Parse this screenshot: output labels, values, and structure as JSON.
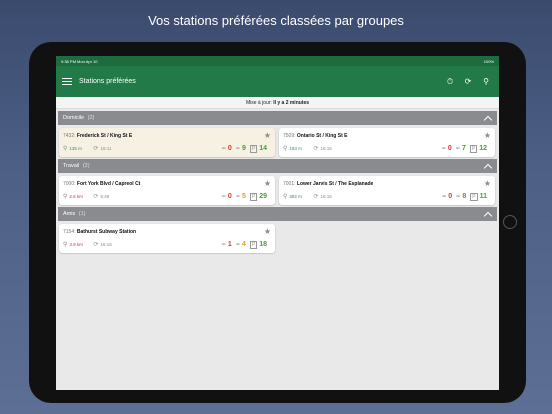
{
  "headline": "Vos stations préférées classées par groupes",
  "statusbar": {
    "left": "9:38 PM  Mon Apr 10",
    "right": "100%"
  },
  "appbar": {
    "title": "Stations préférées",
    "icons": [
      "timer-icon",
      "refresh-icon",
      "search-icon"
    ]
  },
  "update": {
    "label": "Mise à jour:",
    "value": "Il y a 2 minutes"
  },
  "groups": [
    {
      "name": "Domicile",
      "count": "(2)",
      "stations": [
        {
          "code": "7432:",
          "name": "Frederick St / King St E",
          "distance": "135 m",
          "time": "16:11",
          "bikes_broken": "0",
          "bikes": "9",
          "docks": "14",
          "dist_color": "green",
          "bikes_color": "green"
        },
        {
          "code": "7509:",
          "name": "Ontario St / King St E",
          "distance": "183 m",
          "time": "16:16",
          "bikes_broken": "0",
          "bikes": "7",
          "docks": "12",
          "dist_color": "green",
          "bikes_color": "green"
        }
      ]
    },
    {
      "name": "Travail",
      "count": "(2)",
      "stations": [
        {
          "code": "7000:",
          "name": "Fort York Blvd / Capreol Ct",
          "distance": "2.6 km",
          "time": "6:49",
          "bikes_broken": "0",
          "bikes": "5",
          "docks": "29",
          "dist_color": "red",
          "bikes_color": "orange"
        },
        {
          "code": "7001:",
          "name": "Lower Jarvis St / The Esplanade",
          "distance": "382 m",
          "time": "16:16",
          "bikes_broken": "0",
          "bikes": "8",
          "docks": "11",
          "dist_color": "green",
          "bikes_color": "green"
        }
      ]
    },
    {
      "name": "Amis",
      "count": "(1)",
      "stations": [
        {
          "code": "7154:",
          "name": "Bathurst Subway Station",
          "distance": "3.9 km",
          "time": "16:16",
          "bikes_broken": "1",
          "bikes": "4",
          "docks": "18",
          "dist_color": "red",
          "bikes_color": "orange"
        }
      ]
    }
  ],
  "colors": {
    "appbar": "#217a47",
    "group_header": "#8a8b8f",
    "highlight_card": "#f6f1e2"
  }
}
